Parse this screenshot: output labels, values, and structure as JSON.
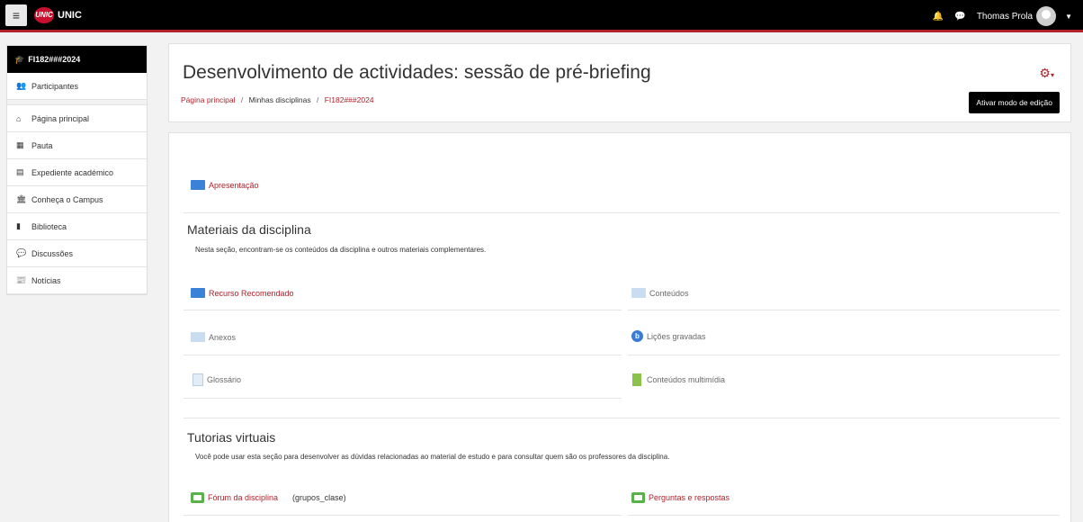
{
  "topbar": {
    "brand": "UNIC",
    "logo_text": "UNIC",
    "user_name": "Thomas Prola"
  },
  "sidebar": {
    "course": "FI182###2024",
    "items": [
      {
        "label": "Participantes",
        "icon": "users-icon"
      },
      {
        "label": "Página principal",
        "icon": "home-icon"
      },
      {
        "label": "Pauta",
        "icon": "grid-icon"
      },
      {
        "label": "Expediente académico",
        "icon": "id-card-icon"
      },
      {
        "label": "Conheça o Campus",
        "icon": "bank-icon"
      },
      {
        "label": "Biblioteca",
        "icon": "book-icon"
      },
      {
        "label": "Discussões",
        "icon": "comments-icon"
      },
      {
        "label": "Notícias",
        "icon": "newspaper-icon"
      }
    ]
  },
  "header": {
    "title": "Desenvolvimento de actividades: sessão de pré-briefing",
    "breadcrumb": [
      "Página principal",
      "Minhas disciplinas",
      "FI182###2024"
    ],
    "edit_button": "Ativar modo de edição"
  },
  "main": {
    "intro": {
      "label": "Apresentação"
    },
    "materiais": {
      "title": "Materiais da disciplina",
      "desc": "Nesta seção, encontram-se os conteúdos da disciplina e outros materiais complementares.",
      "recurso": "Recurso Recomendado",
      "conteudos": "Conteúdos",
      "anexos": "Anexos",
      "licoes": "Lições gravadas",
      "glossario": "Glossário",
      "multimidia": "Conteúdos multimídia"
    },
    "tutorias": {
      "title": "Tutorias virtuais",
      "desc": "Você pode usar esta seção para desenvolver as dúvidas relacionadas ao material de estudo e para consultar quem são os professores da disciplina.",
      "forum": "Fórum da disciplina",
      "forum_suffix": "(grupos_clase)",
      "perguntas": "Perguntas e respostas"
    }
  }
}
